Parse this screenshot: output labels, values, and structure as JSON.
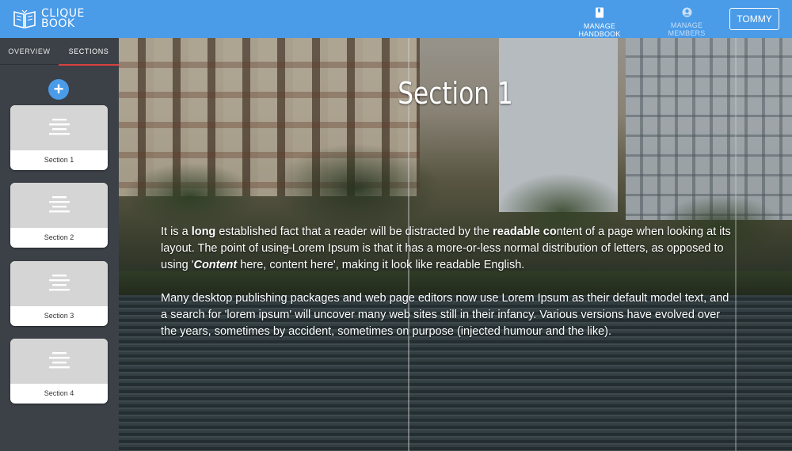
{
  "app": {
    "logo_line1": "CLIQUE",
    "logo_line2": "BOOK",
    "accent_color": "#4a9be8"
  },
  "header": {
    "nav": [
      {
        "label": "MANAGE HANDBOOK",
        "icon": "book-icon"
      },
      {
        "label": "MANAGE MEMBERS",
        "icon": "account-circle-icon"
      }
    ],
    "user_label": "TOMMY"
  },
  "sidebar": {
    "tabs": [
      {
        "label": "OVERVIEW",
        "active": false
      },
      {
        "label": "SECTIONS",
        "active": true
      }
    ],
    "add_icon": "plus-icon",
    "cards": [
      {
        "label": "Section 1",
        "icon": "align-center-icon"
      },
      {
        "label": "Section 2",
        "icon": "align-center-icon"
      },
      {
        "label": "Section 3",
        "icon": "align-center-icon"
      },
      {
        "label": "Section 4",
        "icon": "align-center-icon"
      }
    ]
  },
  "main": {
    "title": "Section 1",
    "p1": {
      "a": "It is a ",
      "b": "long",
      "c": " established fact that a reader will be distracted by the ",
      "d": "readable co",
      "e": "ntent of a page when looking at its layout. The point of usin",
      "f": "g ",
      "g": "Lorem Ipsum is that it has a more-or-less normal distribution of letters, as opposed to using '",
      "h": "Content",
      "i": " here, content here', making it look like readable English."
    },
    "p2": "Many desktop publishing packages and web page editors now use Lorem Ipsum as their default model text, and a search for 'lorem ipsum' will uncover many web sites still in their infancy. Various versions have evolved over the years, sometimes by accident, sometimes on purpose (injected humour and the like)."
  }
}
